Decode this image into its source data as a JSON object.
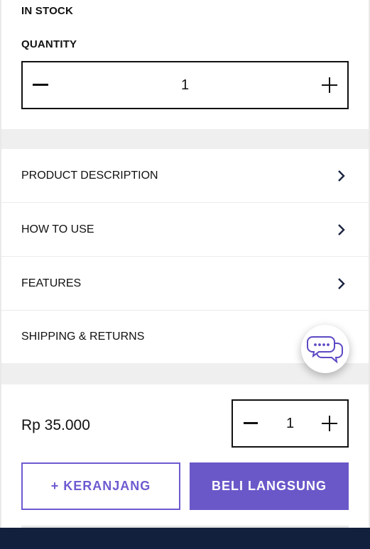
{
  "stock": {
    "label": "IN STOCK"
  },
  "quantity": {
    "label": "QUANTITY",
    "value": "1"
  },
  "accordion": {
    "items": [
      {
        "label": "PRODUCT DESCRIPTION"
      },
      {
        "label": "HOW TO USE"
      },
      {
        "label": "FEATURES"
      },
      {
        "label": "SHIPPING & RETURNS"
      }
    ]
  },
  "purchase_bar": {
    "price": "Rp 35.000",
    "quantity_value": "1",
    "add_to_cart_label": "+ KERANJANG",
    "buy_now_label": "BELI LANGSUNG"
  },
  "icons": {
    "minus": "minus-icon",
    "plus": "plus-icon",
    "chevron": "chevron-right-icon",
    "chat": "chat-icon"
  },
  "colors": {
    "accent": "#6a58c9",
    "accent_border": "#6d5bd0",
    "footer": "#12203d",
    "band": "#efefef"
  }
}
